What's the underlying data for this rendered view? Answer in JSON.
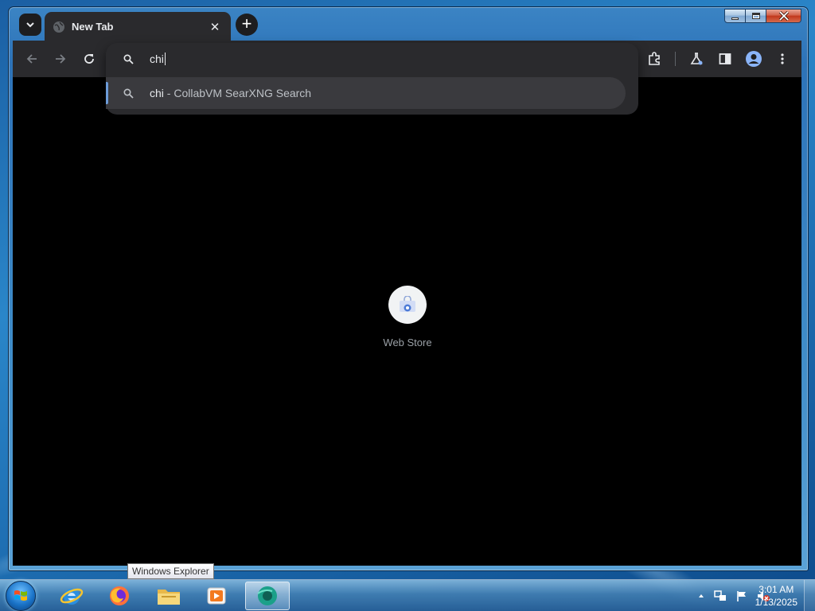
{
  "browser": {
    "tab": {
      "title": "New Tab",
      "close_glyph": "✕"
    },
    "new_tab_glyph": "+",
    "omnibox": {
      "query": "chi",
      "suggestion": {
        "query": "chi",
        "suffix": " - CollabVM SearXNG Search"
      }
    },
    "shortcut": {
      "label": "Web Store",
      "icon": "webstore-icon"
    },
    "accent_color": "#6c9bd8"
  },
  "tooltip": {
    "text": "Windows Explorer"
  },
  "taskbar": {
    "items": [
      {
        "name": "internet-explorer",
        "icon": "ie-icon"
      },
      {
        "name": "firefox",
        "icon": "firefox-icon"
      },
      {
        "name": "windows-explorer",
        "icon": "folder-icon"
      },
      {
        "name": "media-player",
        "icon": "media-player-icon"
      },
      {
        "name": "chromium",
        "icon": "chromium-icon",
        "active": true
      }
    ],
    "clock": {
      "time": "3:01 AM",
      "date": "1/13/2025"
    }
  }
}
